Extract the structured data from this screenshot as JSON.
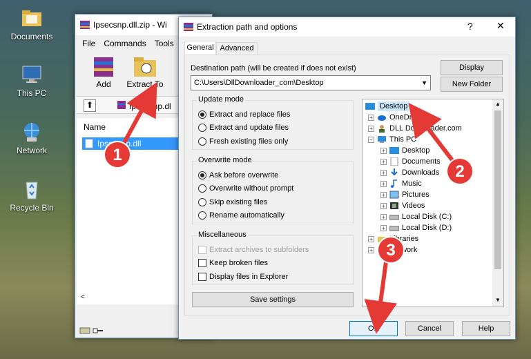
{
  "desktop": {
    "icons": [
      {
        "label": "Documents"
      },
      {
        "label": "This PC"
      },
      {
        "label": "Network"
      },
      {
        "label": "Recycle Bin"
      }
    ]
  },
  "winrar": {
    "title": "Ipsecsnp.dll.zip - Wi",
    "menu": [
      "File",
      "Commands",
      "Tools"
    ],
    "toolbar": {
      "add": "Add",
      "extract_to": "Extract To"
    },
    "path": "Ipsecsnp.dl",
    "column_name": "Name",
    "file": "Ipsecsnp.dll"
  },
  "dialog": {
    "title": "Extraction path and options",
    "help_btn": "?",
    "close_btn": "✕",
    "tabs": [
      "General",
      "Advanced"
    ],
    "dest_label": "Destination path (will be created if does not exist)",
    "dest_value": "C:\\Users\\DllDownloader_com\\Desktop",
    "display_btn": "Display",
    "new_folder_btn": "New Folder",
    "update_mode": {
      "title": "Update mode",
      "options": [
        "Extract and replace files",
        "Extract and update files",
        "Fresh existing files only"
      ]
    },
    "overwrite_mode": {
      "title": "Overwrite mode",
      "options": [
        "Ask before overwrite",
        "Overwrite without prompt",
        "Skip existing files",
        "Rename automatically"
      ]
    },
    "misc": {
      "title": "Miscellaneous",
      "options": [
        "Extract archives to subfolders",
        "Keep broken files",
        "Display files in Explorer"
      ]
    },
    "save_settings": "Save settings",
    "tree": {
      "desktop": "Desktop",
      "onedrive": "OneDrive",
      "user": "DLL Downloader.com",
      "thispc": "This PC",
      "items": [
        "Desktop",
        "Documents",
        "Downloads",
        "Music",
        "Pictures",
        "Videos",
        "Local Disk (C:)",
        "Local Disk (D:)"
      ],
      "libraries": "Libraries",
      "network": "Network"
    },
    "ok": "OK",
    "cancel": "Cancel",
    "help": "Help"
  },
  "annotations": [
    "1",
    "2",
    "3"
  ],
  "colors": {
    "arrow": "#e53935",
    "selection": "#cce8ff",
    "accent": "#0078d7"
  }
}
